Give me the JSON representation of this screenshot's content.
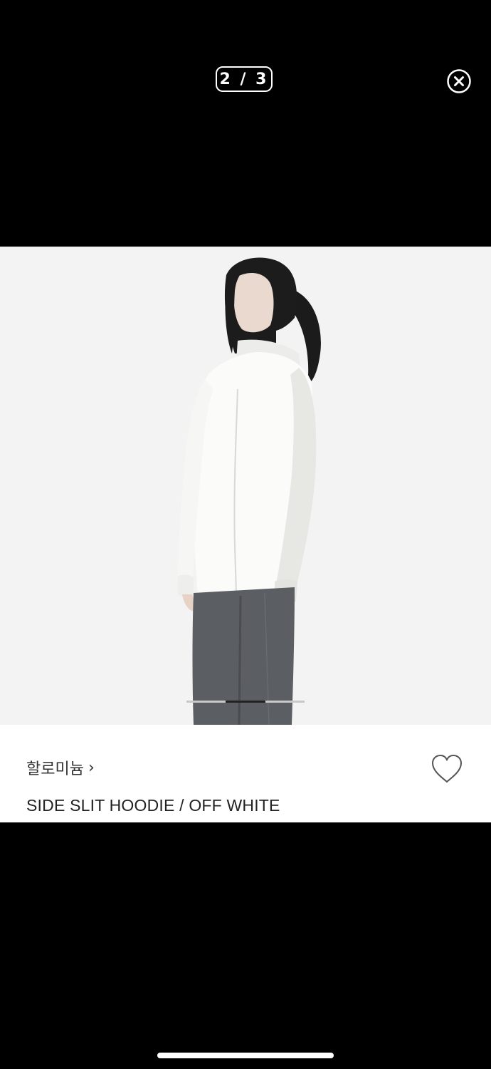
{
  "viewer": {
    "counter": "2 / 3",
    "current_index": 2,
    "total": 3
  },
  "product": {
    "brand": "할로미늄",
    "brand_chevron": "›",
    "title": "SIDE SLIT HOODIE / OFF WHITE"
  },
  "icons": {
    "close": "close-circle-icon",
    "favorite": "heart-outline-icon"
  },
  "colors": {
    "background": "#000000",
    "photo_background": "#f3f3f3",
    "info_background": "#ffffff",
    "indicator_active": "#222222",
    "indicator_inactive": "#c9c9c9"
  }
}
